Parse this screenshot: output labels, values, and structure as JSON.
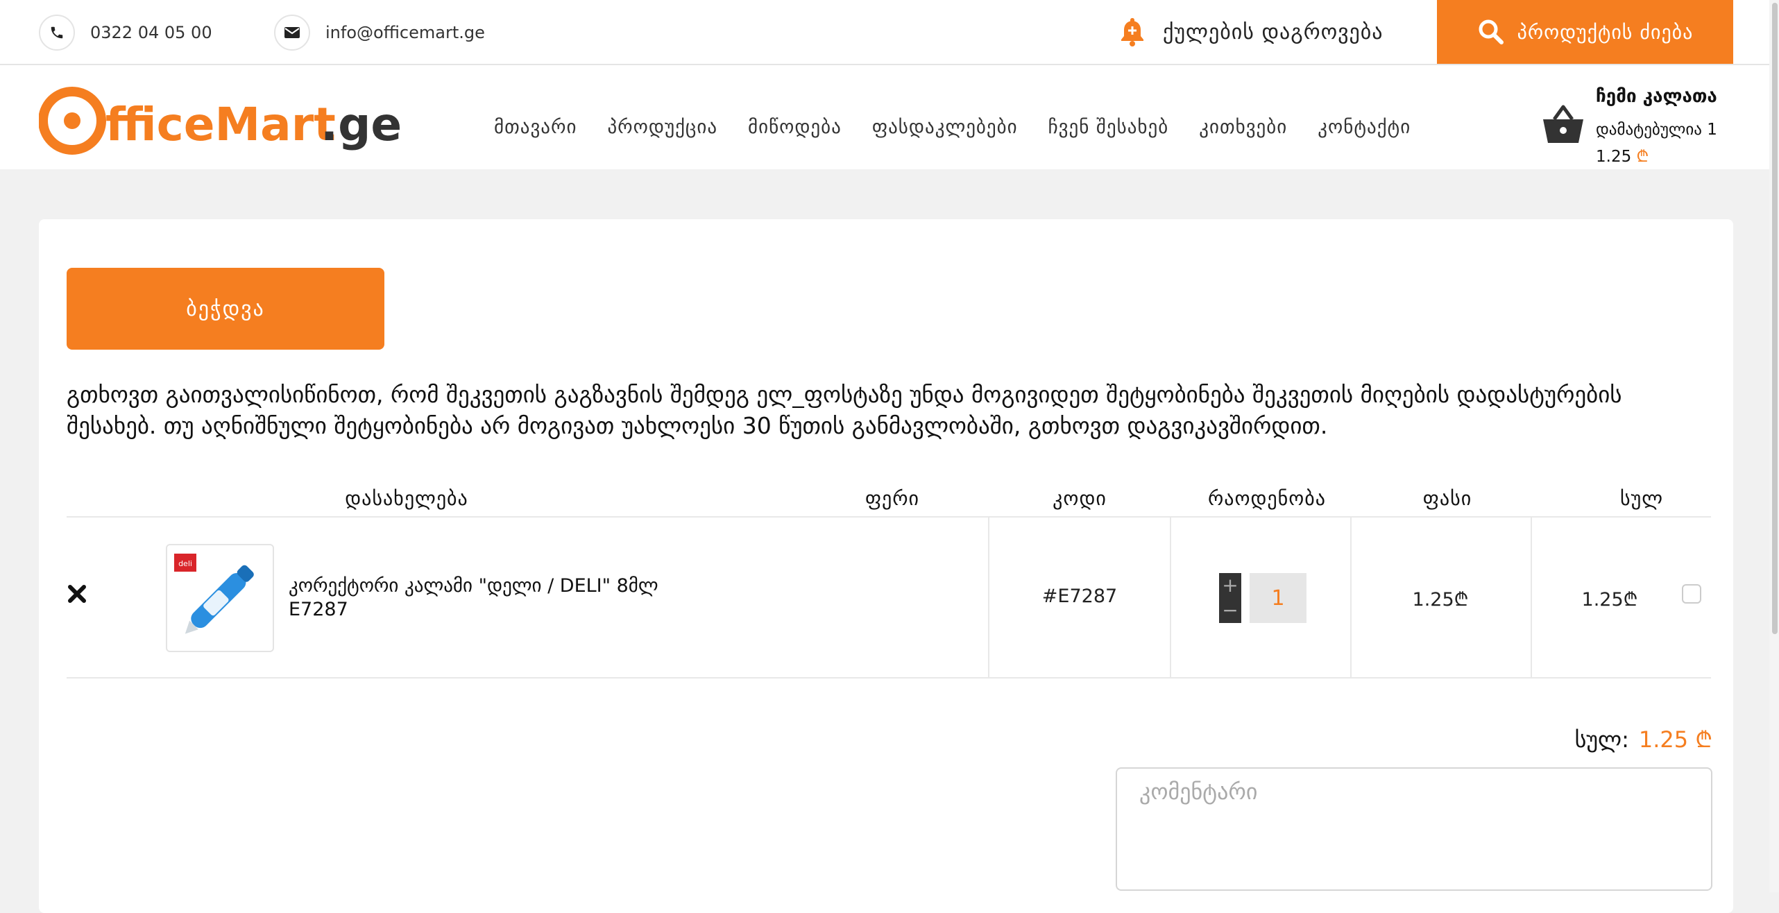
{
  "topbar": {
    "phone": "0322 04 05 00",
    "email": "info@officemart.ge",
    "promo_label": "ქულების დაგროვება",
    "search_label": "პროდუქტის ძიება"
  },
  "header": {
    "logo_text_orange": "fficeMart",
    "logo_text_dark": ".ge",
    "nav": [
      "მთავარი",
      "პროდუქცია",
      "მიწოდება",
      "ფასდაკლებები",
      "ჩვენ შესახებ",
      "კითხვები",
      "კონტაქტი"
    ],
    "cart": {
      "title": "ჩემი კალათა",
      "added": "დამატებულია 1",
      "total": "1.25",
      "currency": "₾"
    }
  },
  "page": {
    "print_label": "ბეჭდვა",
    "notice": "გთხოვთ გაითვალისიწინოთ, რომ შეკვეთის გაგზავნის შემდეგ ელ_ფოსტაზე უნდა მოგივიდეთ შეტყობინება შეკვეთის მიღების დადასტურების შესახებ. თუ აღნიშნული შეტყობინება არ მოგივათ უახლოესი 30 წუთის განმავლობაში, გთხოვთ დაგვიკავშირდით.",
    "columns": {
      "name": "დასახელება",
      "color": "ფერი",
      "code": "კოდი",
      "quantity": "რაოდენობა",
      "price": "ფასი",
      "total": "სულ"
    },
    "items": [
      {
        "name_line1": "კორექტორი კალამი \"დელი / DELI\" 8მლ",
        "name_line2": "E7287",
        "color": "",
        "code": "#E7287",
        "quantity": "1",
        "price": "1.25₾",
        "total": "1.25₾",
        "brand_badge": "deli"
      }
    ],
    "summary_label": "სულ:",
    "summary_value": "1.25",
    "summary_currency": "₾",
    "comment_placeholder": "კომენტარი"
  },
  "colors": {
    "accent": "#f57e20",
    "dark": "#333333"
  }
}
